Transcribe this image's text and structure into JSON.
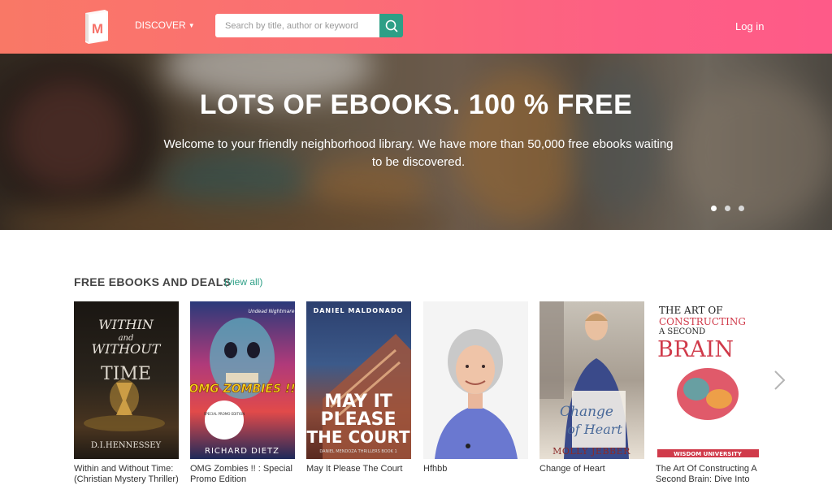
{
  "header": {
    "logo_letter": "M",
    "discover_label": "DISCOVER",
    "search_placeholder": "Search by title, author or keyword",
    "search_value": "",
    "login_label": "Log in",
    "colors": {
      "gradient_start": "#f97866",
      "gradient_end": "#fe5a88",
      "accent": "#2d9f86"
    }
  },
  "hero": {
    "title": "LOTS OF EBOOKS. 100 % FREE",
    "subtitle": "Welcome to your friendly neighborhood library. We have more than 50,000 free ebooks waiting to be discovered.",
    "slide_count": 3,
    "active_slide": 1
  },
  "section": {
    "title": "FREE EBOOKS AND DEALS",
    "view_all": "(view all)"
  },
  "books": [
    {
      "title": "Within and Without Time: (Christian Mystery Thriller)",
      "cover_text": [
        "WITHIN",
        "and",
        "WITHOUT",
        "TIME",
        "D.I.HENNESSEY"
      ]
    },
    {
      "title": "OMG Zombies !! : Special Promo Edition",
      "cover_text": [
        "Undead Nightmare",
        "OMG ZOMBIES !!",
        "SPECIAL PROMO EDITION",
        "RICHARD DIETZ"
      ]
    },
    {
      "title": "May It Please The Court",
      "cover_text": [
        "DANIEL MALDONADO",
        "MAY IT",
        "PLEASE",
        "THE COURT",
        "DANIEL MENDOZA THRILLERS BOOK 1"
      ]
    },
    {
      "title": "Hfhbb",
      "cover_text": []
    },
    {
      "title": "Change of Heart",
      "cover_text": [
        "Change",
        "of Heart",
        "MOLLY JEBBER"
      ]
    },
    {
      "title": "The Art Of Constructing A Second Brain: Dive Into",
      "cover_text": [
        "THE ART OF",
        "CONSTRUCTING",
        "A SECOND",
        "BRAIN",
        "WISDOM UNIVERSITY"
      ]
    }
  ]
}
